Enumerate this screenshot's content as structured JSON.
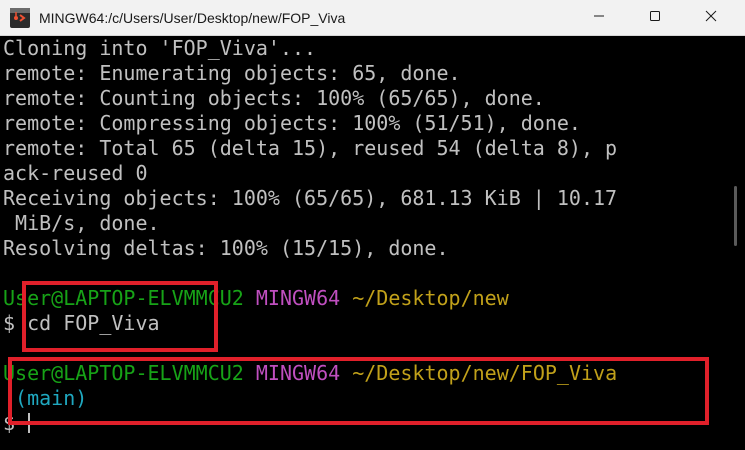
{
  "window": {
    "title": "MINGW64:/c/Users/User/Desktop/new/FOP_Viva",
    "app_icon": "git-bash-icon",
    "controls": {
      "minimize_icon": "minimize-icon",
      "maximize_icon": "maximize-icon",
      "close_icon": "close-icon"
    }
  },
  "terminal": {
    "output_lines": [
      "Cloning into 'FOP_Viva'...",
      "remote: Enumerating objects: 65, done.",
      "remote: Counting objects: 100% (65/65), done.",
      "remote: Compressing objects: 100% (51/51), done.",
      "remote: Total 65 (delta 15), reused 54 (delta 8), p",
      "ack-reused 0",
      "Receiving objects: 100% (65/65), 681.13 KiB | 10.17",
      " MiB/s, done.",
      "Resolving deltas: 100% (15/15), done."
    ],
    "prompt1": {
      "user_host": "User@LAPTOP-ELVMMCU2",
      "shell": "MINGW64",
      "path": "~/Desktop/new"
    },
    "command_line": "$ cd FOP_Viva",
    "prompt2": {
      "user_host": "User@LAPTOP-ELVMMCU2",
      "shell": "MINGW64",
      "path": "~/Desktop/new/FOP_Viva",
      "branch": " (main)"
    },
    "final_prompt": "$ "
  },
  "colors": {
    "background": "#000000",
    "output_text": "#c0c0c0",
    "user_host": "#17a317",
    "shell": "#c04fc0",
    "path": "#c1a11a",
    "branch": "#1fa8c0",
    "highlight": "#e0202a"
  }
}
